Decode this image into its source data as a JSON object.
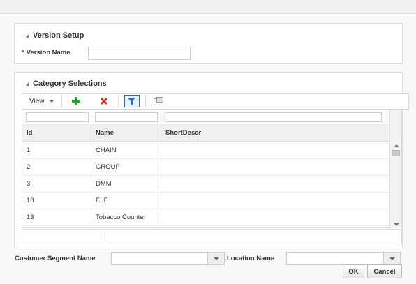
{
  "version_setup": {
    "title": "Version Setup",
    "required_mark": "*",
    "version_name_label": "Version Name",
    "version_name_value": ""
  },
  "category_selections": {
    "title": "Category Selections",
    "toolbar": {
      "view_label": "View",
      "add_icon": "plus-icon",
      "delete_icon": "x-icon",
      "filter_icon": "filter-icon",
      "detach_icon": "detach-icon"
    },
    "columns": [
      "Id",
      "Name",
      "ShortDescr"
    ],
    "rows": [
      {
        "id": "1",
        "name": "CHAIN",
        "short": ""
      },
      {
        "id": "2",
        "name": "GROUP",
        "short": ""
      },
      {
        "id": "3",
        "name": "DMM",
        "short": ""
      },
      {
        "id": "18",
        "name": "ELF",
        "short": ""
      },
      {
        "id": "13",
        "name": "Tobacco Counter",
        "short": ""
      }
    ]
  },
  "bottom": {
    "customer_segment_label": "Customer Segment Name",
    "customer_segment_value": "",
    "location_label": "Location Name",
    "location_value": ""
  },
  "buttons": {
    "ok": "OK",
    "cancel": "Cancel"
  },
  "colors": {
    "add_green": "#2e9e2e",
    "delete_red": "#d93025",
    "filter_blue": "#2b6cb0"
  }
}
